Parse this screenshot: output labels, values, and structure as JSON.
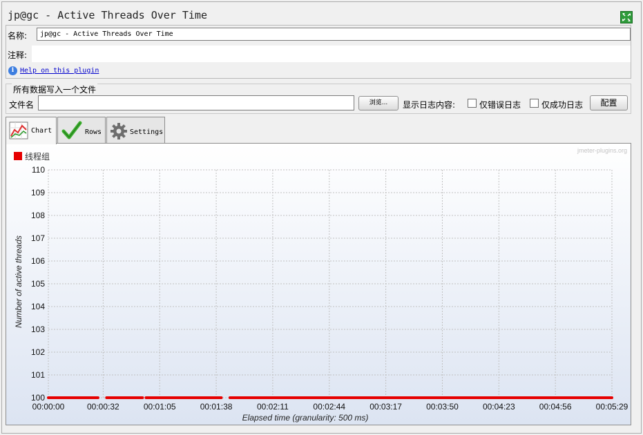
{
  "window": {
    "title": "jp@gc - Active Threads Over Time"
  },
  "name_row": {
    "label": "名称:",
    "value": "jp@gc - Active Threads Over Time"
  },
  "comment_row": {
    "label": "注释:",
    "value": ""
  },
  "help": {
    "link_text": "Help on this plugin"
  },
  "file_section": {
    "legend": "所有数据写入一个文件",
    "file_label": "文件名",
    "file_value": "",
    "browse_label": "浏览...",
    "log_label": "显示日志内容:",
    "errors_only_label": "仅错误日志",
    "errors_only_checked": false,
    "success_only_label": "仅成功日志",
    "success_only_checked": false,
    "configure_label": "配置"
  },
  "tabs": [
    {
      "label": "Chart",
      "icon": "chart-icon",
      "active": true
    },
    {
      "label": "Rows",
      "icon": "checkmark-icon",
      "active": false
    },
    {
      "label": "Settings",
      "icon": "gear-icon",
      "active": false
    }
  ],
  "watermark": "jmeter-plugins.org",
  "colors": {
    "series": "#e60000",
    "plot_bg_top": "#ffffff",
    "plot_bg_bottom": "#dce4f2"
  },
  "chart_data": {
    "type": "line",
    "xlabel": "Elapsed time (granularity: 500 ms)",
    "ylabel": "Number of active threads",
    "ylim": [
      100,
      110
    ],
    "xlim": [
      "00:00:00",
      "00:05:29"
    ],
    "yticks": [
      "100",
      "101",
      "102",
      "103",
      "104",
      "105",
      "106",
      "107",
      "108",
      "109",
      "110"
    ],
    "xticks": [
      "00:00:00",
      "00:00:32",
      "00:01:05",
      "00:01:38",
      "00:02:11",
      "00:02:44",
      "00:03:17",
      "00:03:50",
      "00:04:23",
      "00:04:56",
      "00:05:29"
    ],
    "grid": true,
    "legend_position": "top-left",
    "series": [
      {
        "name": "线程组",
        "color": "#e60000",
        "segments": [
          {
            "x": [
              "00:00:00",
              "00:00:29"
            ],
            "y": [
              100,
              100
            ]
          },
          {
            "x": [
              "00:00:34",
              "00:00:55"
            ],
            "y": [
              100,
              100
            ]
          },
          {
            "x": [
              "00:00:57",
              "00:01:41"
            ],
            "y": [
              100,
              100
            ]
          },
          {
            "x": [
              "00:01:46",
              "00:05:29"
            ],
            "y": [
              100,
              100
            ]
          }
        ]
      }
    ]
  }
}
